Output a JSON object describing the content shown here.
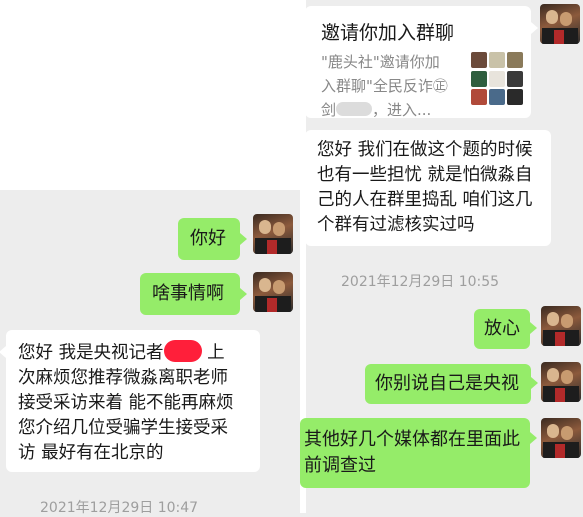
{
  "invite_card": {
    "title": "邀请你加入群聊",
    "desc_line1": "\"鹿头社\"邀请你加",
    "desc_line2": "入群聊\"全民反诈㊣",
    "desc_line3_prefix": "剑",
    "desc_line3_suffix": "，进入..."
  },
  "messages": [
    {
      "id": "m1",
      "side": "right",
      "style": "white",
      "lines": [
        "您好 我们在做这个题的时候",
        "也有一些担忧 就是怕微淼自",
        "己的人在群里捣乱 咱们这几",
        "个群有过滤核实过吗"
      ]
    },
    {
      "id": "m2",
      "side": "left",
      "style": "green",
      "text": "你好"
    },
    {
      "id": "m3",
      "side": "left",
      "style": "green",
      "text": "啥事情啊"
    },
    {
      "id": "m4",
      "side": "right",
      "style": "green",
      "text": "放心"
    },
    {
      "id": "m5",
      "side": "right",
      "style": "green",
      "text": "你别说自己是央视"
    },
    {
      "id": "m6",
      "side": "right",
      "style": "green",
      "lines": [
        "其他好几个媒体都在里面此",
        "前调查过"
      ]
    },
    {
      "id": "m7",
      "side": "left",
      "style": "white",
      "line1_prefix": "您好 我是央视记者",
      "line1_suffix": " 上",
      "lines": [
        "次麻烦您推荐微淼离职老师",
        "接受采访来着 能不能再麻烦",
        "您介绍几位受骗学生接受采",
        "访 最好有在北京的"
      ]
    }
  ],
  "timestamps": {
    "right_panel": "2021年12月29日 10:55",
    "left_panel_bottom": "2021年12月29日 10:47"
  },
  "colors": {
    "chat_bg": "#ededed",
    "bubble_green": "#95ec69",
    "bubble_white": "#ffffff",
    "timestamp": "#9e9e9e",
    "redaction": "#ff1f3a"
  },
  "icons": [
    "avatar",
    "group-thumbnail-grid"
  ]
}
